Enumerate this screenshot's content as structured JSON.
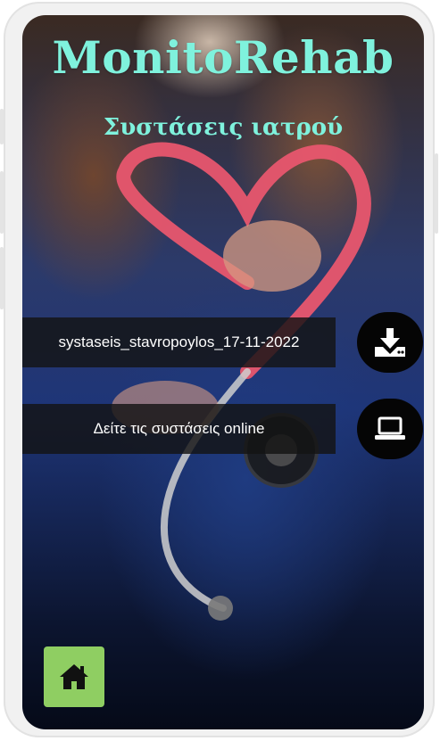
{
  "app": {
    "title": "MonitoRehab",
    "subtitle": "Συστάσεις ιατρού"
  },
  "download": {
    "file_name": "systaseis_stavropoylos_17-11-2022",
    "icon": "download-icon"
  },
  "online": {
    "label": "Δείτε τις συστάσεις online",
    "icon": "laptop-icon"
  },
  "nav": {
    "home_icon": "home-icon"
  },
  "colors": {
    "title": "#7ff2dd",
    "home_button": "#8fce62",
    "bar_background": "#141414",
    "circle_button": "#050505"
  }
}
